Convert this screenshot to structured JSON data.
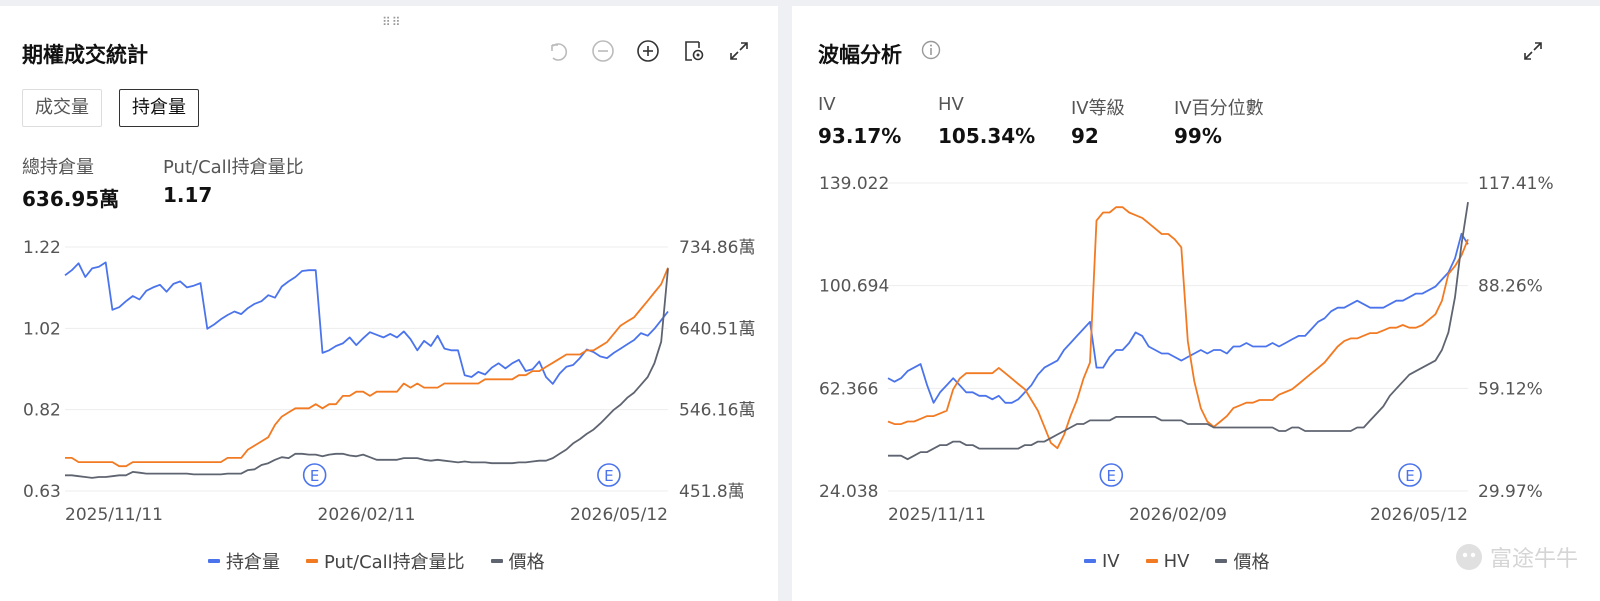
{
  "colors": {
    "blue": "#4b74ec",
    "orange": "#f27a22",
    "gray": "#5e6470",
    "grid": "#ededed",
    "axis": "#555555"
  },
  "left_panel": {
    "title": "期權成交統計",
    "icons": [
      "undo-icon",
      "zoom-out-icon",
      "zoom-in-icon",
      "settings-icon",
      "expand-icon"
    ],
    "tabs": [
      {
        "label": "成交量",
        "active": false
      },
      {
        "label": "持倉量",
        "active": true
      }
    ],
    "stats": [
      {
        "label": "總持倉量",
        "value": "636.95萬"
      },
      {
        "label": "Put/Call持倉量比",
        "value": "1.17"
      }
    ],
    "legend": [
      "持倉量",
      "Put/Call持倉量比",
      "價格"
    ]
  },
  "right_panel": {
    "title": "波幅分析",
    "icons": [
      "info-icon",
      "expand-icon"
    ],
    "stats": [
      {
        "label": "IV",
        "value": "93.17%"
      },
      {
        "label": "HV",
        "value": "105.34%"
      },
      {
        "label": "IV等級",
        "value": "92"
      },
      {
        "label": "IV百分位數",
        "value": "99%"
      }
    ],
    "legend": [
      "IV",
      "HV",
      "價格"
    ],
    "watermark": "富途牛牛"
  },
  "chart_data": [
    {
      "type": "line",
      "x_ticks": [
        "2025/11/11",
        "2026/02/11",
        "2026/05/12"
      ],
      "y_left_ticks": [
        "1.22",
        "1.02",
        "0.82",
        "0.63"
      ],
      "y_right_ticks": [
        "734.86萬",
        "640.51萬",
        "546.16萬",
        "451.8萬"
      ],
      "y_left_range": [
        0.63,
        1.22
      ],
      "y_right_range": [
        451.8,
        734.86
      ],
      "markers": [
        {
          "label": "E",
          "x": 0.414
        },
        {
          "label": "E",
          "x": 0.902
        }
      ],
      "series": [
        {
          "name": "持倉量",
          "axis": "right",
          "color": "#4b74ec",
          "values": [
            702,
            708,
            716,
            700,
            710,
            712,
            717,
            662,
            665,
            672,
            678,
            674,
            684,
            688,
            691,
            683,
            692,
            695,
            688,
            690,
            693,
            640,
            645,
            651,
            656,
            660,
            657,
            664,
            669,
            672,
            679,
            676,
            689,
            695,
            700,
            707,
            708,
            708,
            612,
            615,
            620,
            623,
            630,
            621,
            629,
            636,
            633,
            630,
            634,
            630,
            637,
            628,
            615,
            626,
            620,
            632,
            617,
            615,
            615,
            586,
            584,
            590,
            587,
            595,
            600,
            594,
            600,
            604,
            591,
            593,
            602,
            584,
            576,
            588,
            596,
            598,
            606,
            616,
            613,
            608,
            606,
            612,
            617,
            622,
            627,
            635,
            632,
            640,
            650,
            660
          ]
        },
        {
          "name": "Put/Call持倉量比",
          "axis": "left",
          "color": "#f27a22",
          "values": [
            0.71,
            0.71,
            0.7,
            0.7,
            0.7,
            0.7,
            0.7,
            0.7,
            0.69,
            0.69,
            0.7,
            0.7,
            0.7,
            0.7,
            0.7,
            0.7,
            0.7,
            0.7,
            0.7,
            0.7,
            0.7,
            0.7,
            0.7,
            0.7,
            0.71,
            0.71,
            0.71,
            0.73,
            0.74,
            0.75,
            0.76,
            0.79,
            0.81,
            0.82,
            0.83,
            0.83,
            0.83,
            0.84,
            0.83,
            0.84,
            0.84,
            0.86,
            0.86,
            0.87,
            0.87,
            0.86,
            0.87,
            0.87,
            0.87,
            0.87,
            0.89,
            0.88,
            0.89,
            0.88,
            0.88,
            0.88,
            0.89,
            0.89,
            0.89,
            0.89,
            0.89,
            0.89,
            0.9,
            0.9,
            0.9,
            0.9,
            0.9,
            0.91,
            0.91,
            0.92,
            0.92,
            0.93,
            0.94,
            0.95,
            0.96,
            0.96,
            0.96,
            0.97,
            0.97,
            0.98,
            0.99,
            1.01,
            1.03,
            1.04,
            1.05,
            1.07,
            1.09,
            1.11,
            1.13,
            1.17
          ]
        },
        {
          "name": "價格",
          "axis": "right",
          "color": "#5e6470",
          "values": [
            470,
            470,
            469,
            468,
            467,
            468,
            468,
            469,
            470,
            470,
            474,
            473,
            472,
            472,
            472,
            472,
            472,
            472,
            472,
            471,
            471,
            471,
            471,
            471,
            472,
            472,
            472,
            476,
            477,
            482,
            484,
            488,
            491,
            490,
            495,
            495,
            494,
            494,
            492,
            494,
            495,
            495,
            493,
            492,
            494,
            491,
            488,
            488,
            488,
            488,
            490,
            490,
            490,
            488,
            487,
            488,
            487,
            486,
            485,
            486,
            485,
            485,
            485,
            484,
            484,
            484,
            484,
            485,
            485,
            486,
            487,
            487,
            490,
            495,
            500,
            507,
            512,
            518,
            523,
            530,
            538,
            546,
            552,
            560,
            566,
            575,
            584,
            600,
            625,
            710
          ]
        }
      ]
    },
    {
      "type": "line",
      "x_ticks": [
        "2025/11/11",
        "2026/02/09",
        "2026/05/12"
      ],
      "y_left_ticks": [
        "139.022",
        "100.694",
        "62.366",
        "24.038"
      ],
      "y_right_ticks": [
        "117.41%",
        "88.26%",
        "59.12%",
        "29.97%"
      ],
      "y_left_range": [
        24.038,
        139.022
      ],
      "y_right_range": [
        29.97,
        117.41
      ],
      "markers": [
        {
          "label": "E",
          "x": 0.385
        },
        {
          "label": "E",
          "x": 0.9
        }
      ],
      "series": [
        {
          "name": "IV",
          "axis": "right",
          "color": "#4b74ec",
          "values": [
            62,
            61,
            62,
            64,
            65,
            66,
            60,
            55,
            58,
            60,
            62,
            60,
            58,
            58,
            57,
            57,
            56,
            57,
            55,
            55,
            56,
            58,
            60,
            63,
            65,
            66,
            67,
            70,
            72,
            74,
            76,
            78,
            65,
            65,
            68,
            70,
            70,
            72,
            75,
            74,
            71,
            70,
            69,
            69,
            68,
            67,
            68,
            69,
            70,
            69,
            70,
            70,
            69,
            71,
            71,
            72,
            71,
            71,
            71,
            72,
            71,
            72,
            73,
            74,
            74,
            76,
            78,
            79,
            81,
            82,
            82,
            83,
            84,
            83,
            82,
            82,
            82,
            83,
            84,
            84,
            85,
            86,
            86,
            87,
            88,
            90,
            92,
            96,
            103,
            100
          ]
        },
        {
          "name": "HV",
          "axis": "left",
          "color": "#f27a22",
          "values": [
            50,
            49,
            49,
            50,
            50,
            51,
            52,
            52,
            53,
            54,
            62,
            66,
            68,
            68,
            68,
            68,
            68,
            70,
            68,
            66,
            64,
            62,
            58,
            54,
            48,
            42,
            40,
            45,
            52,
            58,
            66,
            72,
            125,
            128,
            128,
            130,
            130,
            128,
            127,
            126,
            124,
            122,
            120,
            120,
            118,
            115,
            80,
            65,
            55,
            50,
            48,
            50,
            52,
            55,
            56,
            57,
            57,
            58,
            58,
            58,
            60,
            61,
            62,
            64,
            66,
            68,
            70,
            72,
            75,
            78,
            80,
            81,
            81,
            82,
            83,
            83,
            84,
            85,
            85,
            86,
            85,
            85,
            86,
            88,
            90,
            95,
            105,
            108,
            112,
            118
          ]
        },
        {
          "name": "價格",
          "axis": "right",
          "color": "#5e6470",
          "values": [
            40,
            40,
            40,
            39,
            40,
            41,
            41,
            42,
            43,
            43,
            44,
            44,
            43,
            43,
            42,
            42,
            42,
            42,
            42,
            42,
            42,
            43,
            43,
            44,
            44,
            45,
            46,
            47,
            48,
            49,
            49,
            50,
            50,
            50,
            50,
            51,
            51,
            51,
            51,
            51,
            51,
            51,
            50,
            50,
            50,
            50,
            49,
            49,
            49,
            49,
            48,
            48,
            48,
            48,
            48,
            48,
            48,
            48,
            48,
            48,
            47,
            47,
            48,
            48,
            47,
            47,
            47,
            47,
            47,
            47,
            47,
            47,
            48,
            48,
            50,
            52,
            54,
            57,
            59,
            61,
            63,
            64,
            65,
            66,
            67,
            70,
            75,
            85,
            100,
            112
          ]
        }
      ]
    }
  ]
}
